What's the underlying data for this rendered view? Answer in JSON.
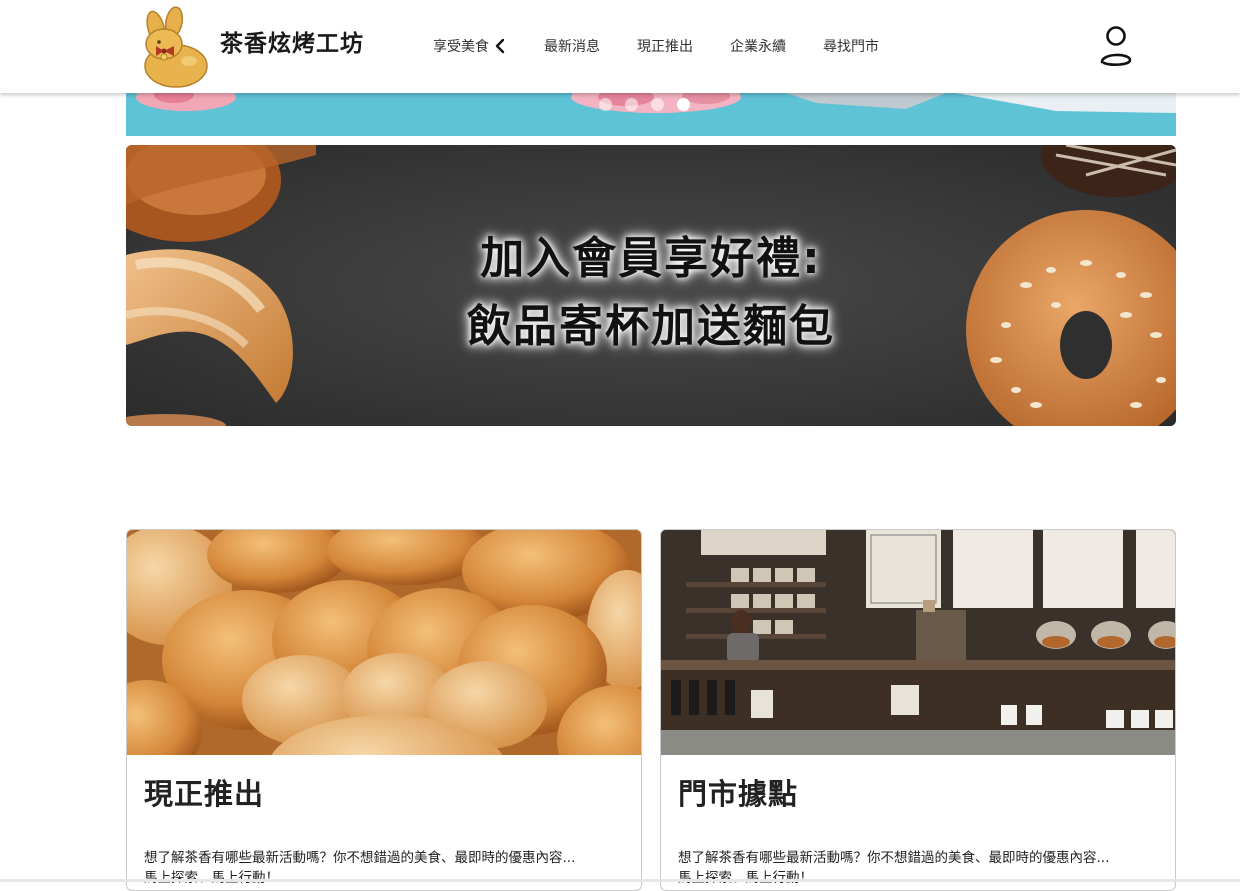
{
  "brand": {
    "name": "茶香炫烤工坊",
    "logo_icon": "bunny-logo-icon"
  },
  "nav": {
    "items": [
      {
        "label": "享受美食",
        "has_dropdown": true
      },
      {
        "label": "最新消息"
      },
      {
        "label": "現正推出"
      },
      {
        "label": "企業永續"
      },
      {
        "label": "尋找門市"
      }
    ],
    "user_icon": "user-icon"
  },
  "carousel": {
    "slide_count": 4,
    "active_index": 3
  },
  "banner": {
    "line1": "加入會員享好禮:",
    "line2": "飲品寄杯加送麵包"
  },
  "cards": [
    {
      "title": "現正推出",
      "desc_line1": "想了解茶香有哪些最新活動嗎？你不想錯過的美食、最即時的優惠內容...",
      "desc_line2": "馬上探索、馬上行動！"
    },
    {
      "title": "門市據點",
      "desc_line1": "想了解茶香有哪些最新活動嗎？你不想錯過的美食、最即時的優惠內容...",
      "desc_line2": "馬上探索、馬上行動！"
    }
  ],
  "colors": {
    "carousel_bg": "#5fc3d6",
    "banner_bg": "#3a3a3a",
    "bread_gold": "#d9923a"
  }
}
